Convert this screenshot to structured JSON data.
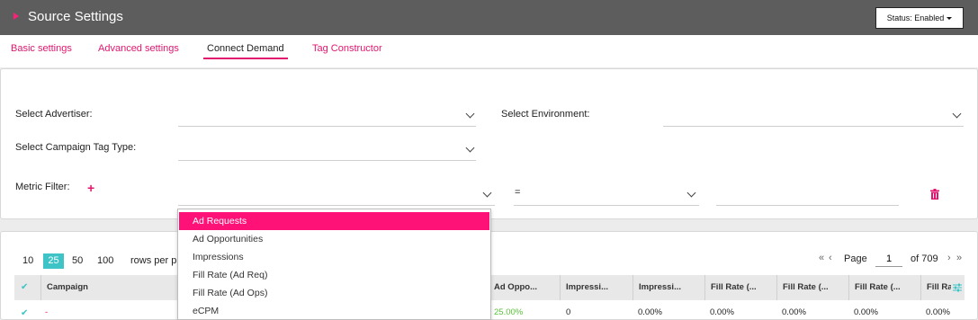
{
  "header": {
    "title": "Source Settings",
    "status_label": "Status: Enabled"
  },
  "tabs": [
    {
      "label": "Basic settings",
      "active": false
    },
    {
      "label": "Advanced settings",
      "active": false
    },
    {
      "label": "Connect Demand",
      "active": true
    },
    {
      "label": "Tag Constructor",
      "active": false
    }
  ],
  "filters": {
    "advertiser_label": "Select Advertiser:",
    "environment_label": "Select Environment:",
    "campaign_tag_type_label": "Select Campaign Tag Type:",
    "metric_filter_label": "Metric Filter:",
    "operator_value": "="
  },
  "pagination": {
    "sizes": [
      "10",
      "25",
      "50",
      "100"
    ],
    "selected_size": "25",
    "rows_per_page_label": "rows per p",
    "page_label": "Page",
    "current_page": "1",
    "total_pages_label": "of 709"
  },
  "table": {
    "columns": [
      "Campaign",
      "Ad Oppo...",
      "Impressi...",
      "Impressi...",
      "Fill Rate (...",
      "Fill Rate (...",
      "Fill Rate (...",
      "Fill Ra"
    ],
    "row": [
      "-",
      "25.00%",
      "0",
      "0.00%",
      "0.00%",
      "0.00%",
      "0.00%",
      "0.00%"
    ]
  },
  "metric_dropdown": {
    "options": [
      "Ad Requests",
      "Ad Opportunities",
      "Impressions",
      "Fill Rate (Ad Req)",
      "Fill Rate (Ad Ops)",
      "eCPM"
    ],
    "highlighted": "Ad Requests"
  },
  "colors": {
    "accent": "#e3166f",
    "highlight": "#ff1278",
    "teal": "#3ec3c7",
    "header_bg": "#5d5d5d"
  }
}
